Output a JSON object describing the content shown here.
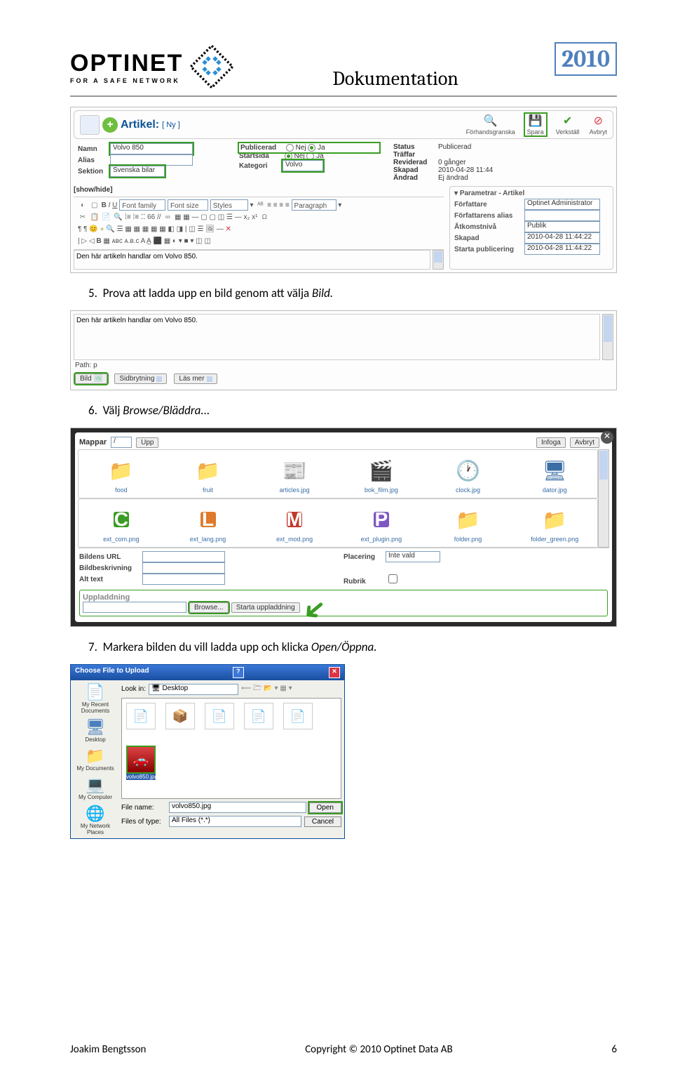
{
  "header": {
    "logo_title": "OPTINET",
    "logo_sub": "FOR A SAFE NETWORK",
    "doc_title": "Dokumentation",
    "year": "2010"
  },
  "shot1": {
    "title_label": "Artikel:",
    "title_sub": "[ Ny ]",
    "actions": {
      "preview": "Förhandsgranska",
      "save": "Spara",
      "apply": "Verkställ",
      "cancel": "Avbryt"
    },
    "left": {
      "namn_lbl": "Namn",
      "namn_val": "Volvo 850",
      "alias_lbl": "Alias",
      "alias_val": "",
      "sektion_lbl": "Sektion",
      "sektion_val": "Svenska bilar"
    },
    "mid": {
      "pub_lbl": "Publicerad",
      "nej": "Nej",
      "ja": "Ja",
      "start_lbl": "Startsida",
      "kat_lbl": "Kategori",
      "kat_val": "Volvo"
    },
    "meta": {
      "status_lbl": "Status",
      "status_val": "Publicerad",
      "traffar_lbl": "Träffar",
      "traffar_val": "",
      "rev_lbl": "Reviderad",
      "rev_val": "0 gånger",
      "skapad_lbl": "Skapad",
      "skapad_val": "2010-04-28 11:44",
      "andrad_lbl": "Ändrad",
      "andrad_val": "Ej ändrad"
    },
    "showhide": "[show/hide]",
    "toolbar": {
      "ff": "Font family",
      "fs": "Font size",
      "styles": "Styles",
      "para": "Paragraph"
    },
    "params": {
      "head": "Parametrar - Artikel",
      "forf_lbl": "Författare",
      "forf_val": "Optinet Administrator",
      "alias_lbl": "Författarens alias",
      "alias_val": "",
      "atkomst_lbl": "Åtkomstnivå",
      "atkomst_val": "Publik",
      "skapad_lbl": "Skapad",
      "skapad_val": "2010-04-28 11:44:22",
      "startpub_lbl": "Starta publicering",
      "startpub_val": "2010-04-28 11:44:22"
    },
    "body_text": "Den här artikeln handlar om Volvo 850."
  },
  "step5": {
    "num": "5.",
    "text": "Prova att ladda upp en bild genom att välja ",
    "em": "Bild."
  },
  "shot2": {
    "body_text": "Den här artikeln handlar om Volvo 850.",
    "path_lbl": "Path: p",
    "bild": "Bild",
    "sid": "Sidbrytning",
    "las": "Läs mer"
  },
  "step6": {
    "num": "6.",
    "text": "Välj ",
    "em": "Browse/Bläddra..."
  },
  "shot3": {
    "mappar": "Mappar",
    "slash": "/",
    "upp": "Upp",
    "infoga": "Infoga",
    "avbryt": "Avbryt",
    "files1": [
      "food",
      "fruit",
      "articles.jpg",
      "bok_film.jpg",
      "clock.jpg",
      "dator.jpg"
    ],
    "letters": [
      "C",
      "L",
      "M",
      "P"
    ],
    "lcolors": [
      "#3a9d23",
      "#e07a2c",
      "#c0392b",
      "#7e57c2"
    ],
    "files2": [
      "ext_com.png",
      "ext_lang.png",
      "ext_mod.png",
      "ext_plugin.png",
      "folder.png",
      "folder_green.png"
    ],
    "form": {
      "url": "Bildens URL",
      "desc": "Bildbeskrivning",
      "alt": "Alt text",
      "plac": "Placering",
      "plac_val": "Inte vald",
      "rubrik": "Rubrik"
    },
    "upload": {
      "head": "Uppladdning",
      "browse": "Browse...",
      "start": "Starta uppladdning"
    }
  },
  "step7": {
    "num": "7.",
    "text": "Markera bilden du vill ladda upp och klicka ",
    "em": "Open/Öppna."
  },
  "shot4": {
    "title": "Choose File to Upload",
    "lookin": "Look in:",
    "lookin_val": "Desktop",
    "side": [
      "My Recent Documents",
      "Desktop",
      "My Documents",
      "My Computer",
      "My Network Places"
    ],
    "files_top": [
      "",
      "",
      ""
    ],
    "files_bot": [
      "",
      "",
      "volvo850.jpg"
    ],
    "filename_lbl": "File name:",
    "filename_val": "volvo850.jpg",
    "filetype_lbl": "Files of type:",
    "filetype_val": "All Files (*.*)",
    "open": "Open",
    "cancel": "Cancel"
  },
  "footer": {
    "author": "Joakim Bengtsson",
    "copyright": "Copyright © 2010 Optinet Data AB",
    "page": "6"
  }
}
